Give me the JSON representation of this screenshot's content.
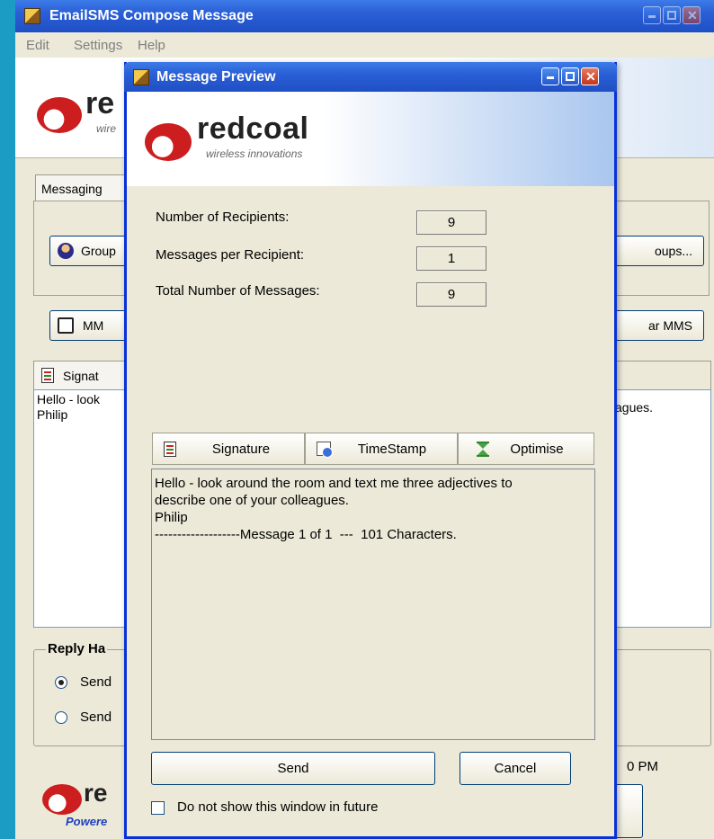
{
  "main_window": {
    "title": "EmailSMS Compose Message",
    "menu": [
      "Edit",
      "Settings",
      "Help"
    ],
    "logo": {
      "word": "re",
      "sub": "wire"
    },
    "tab_label": "Messaging",
    "groups_button": "Group",
    "groups_button_right": "oups...",
    "mms_button": "MM",
    "mms_button_right": "ar MMS",
    "signature_tab": "Signat",
    "message_text": "Hello - look",
    "message_text_line2": "Philip",
    "message_right_fragment": "lleagues.",
    "reply_group_label": "Reply Ha",
    "send_option_1": "Send",
    "send_option_2": "Send",
    "time_fragment": "0 PM",
    "footer_logo_word": "re",
    "footer_logo_sub": "Powere"
  },
  "dialog": {
    "title": "Message Preview",
    "logo": {
      "word": "redcoal",
      "tagline": "wireless innovations"
    },
    "stats": [
      {
        "label": "Number of Recipients:",
        "value": "9"
      },
      {
        "label": "Messages per Recipient:",
        "value": "1"
      },
      {
        "label": "Total Number of Messages:",
        "value": "9"
      }
    ],
    "tabs": [
      {
        "label": "Signature",
        "icon": "document-icon"
      },
      {
        "label": "TimeStamp",
        "icon": "timestamp-icon"
      },
      {
        "label": "Optimise",
        "icon": "hourglass-icon"
      }
    ],
    "message": "Hello - look around the room and text me three adjectives to\ndescribe one of your colleagues.\nPhilip\n-------------------Message 1 of 1  ---  101 Characters.",
    "send_label": "Send",
    "cancel_label": "Cancel",
    "checkbox_label": "Do not show this window in future"
  },
  "colors": {
    "desktop": "#1a9cc4",
    "title_blue": "#2a5fd6",
    "window_face": "#ece9d8",
    "logo_red": "#cc1e1e"
  }
}
